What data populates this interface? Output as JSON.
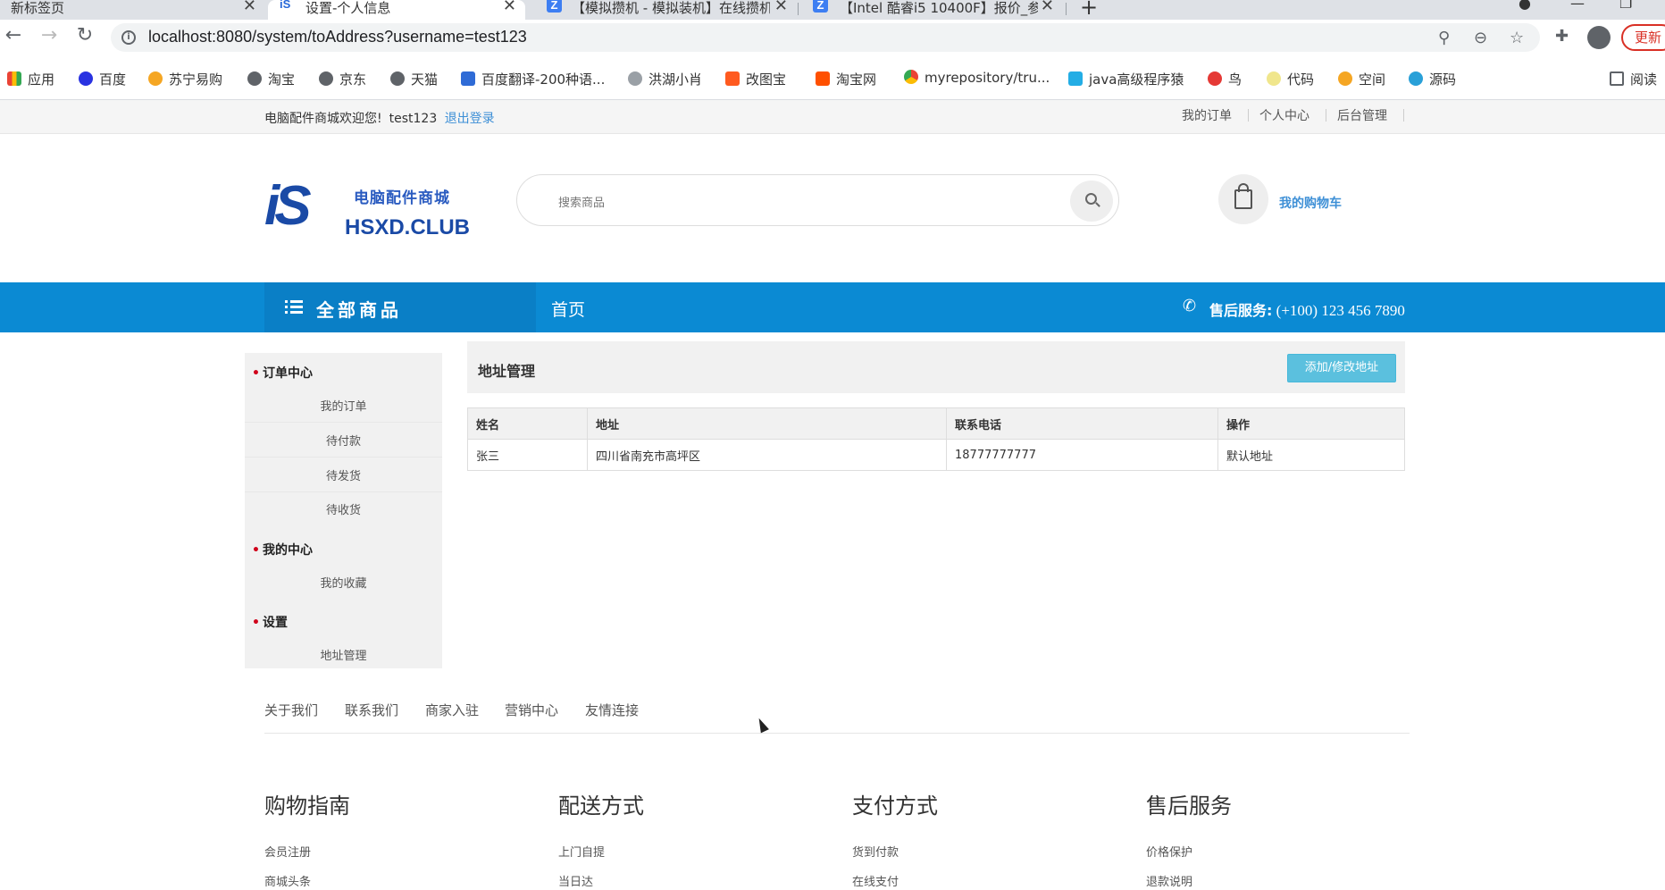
{
  "browser": {
    "tabs": [
      {
        "title": "新标签页",
        "close": "✕"
      },
      {
        "title": "设置-个人信息",
        "close": "✕"
      },
      {
        "title": "【模拟攒机 - 模拟装机】在线攒机",
        "close": "✕"
      },
      {
        "title": "【Intel 酷睿i5 10400F】报价_参",
        "close": "✕"
      }
    ],
    "favicons": {
      "active": "iS",
      "z": "Z"
    },
    "new_tab": "+",
    "url": "localhost:8080/system/toAddress?username=test123",
    "update_label": "更新",
    "bookmarks": [
      "应用",
      "百度",
      "苏宁易购",
      "淘宝",
      "京东",
      "天猫",
      "百度翻译-200种语...",
      "洪湖小肖",
      "改图宝",
      "淘宝网",
      "myrepository/tru...",
      "java高级程序猿",
      "鸟",
      "代码",
      "空间",
      "源码"
    ],
    "reading_list": "阅读",
    "colors": {
      "chrome_bg": "#dee1e6",
      "update_red": "#d93025"
    }
  },
  "site": {
    "welcome": "电脑配件商城欢迎您!",
    "username": "test123",
    "logout": "退出登录",
    "top_links": [
      "我的订单",
      "个人中心",
      "后台管理"
    ],
    "logo": {
      "mark": "iS",
      "cn": "电脑配件商城",
      "en": "HSXD.CLUB"
    },
    "search_placeholder": "搜索商品",
    "cart_label": "我的购物车",
    "nav": {
      "all_products": "全部商品",
      "home": "首页",
      "service_label": "售后服务:",
      "service_phone": "(+100) 123 456 7890"
    },
    "colors": {
      "nav_blue": "#0b8ad3",
      "link_blue": "#3d8fd6",
      "button_cyan": "#5bc0de"
    }
  },
  "sidebar": {
    "sections": [
      {
        "title": "订单中心",
        "items": [
          "我的订单",
          "待付款",
          "待发货",
          "待收货"
        ]
      },
      {
        "title": "我的中心",
        "items": [
          "我的收藏"
        ]
      },
      {
        "title": "设置",
        "items": [
          "地址管理"
        ]
      }
    ]
  },
  "main": {
    "title": "地址管理",
    "add_button": "添加/修改地址",
    "table": {
      "headers": [
        "姓名",
        "地址",
        "联系电话",
        "操作"
      ],
      "rows": [
        [
          "张三",
          "四川省南充市高坪区",
          "18777777777",
          "默认地址"
        ]
      ]
    }
  },
  "footer": {
    "links": [
      "关于我们",
      "联系我们",
      "商家入驻",
      "营销中心",
      "友情连接"
    ],
    "columns": [
      {
        "title": "购物指南",
        "items": [
          "会员注册",
          "商城头条"
        ]
      },
      {
        "title": "配送方式",
        "items": [
          "上门自提",
          "当日达"
        ]
      },
      {
        "title": "支付方式",
        "items": [
          "货到付款",
          "在线支付"
        ]
      },
      {
        "title": "售后服务",
        "items": [
          "价格保护",
          "退款说明"
        ]
      }
    ]
  }
}
